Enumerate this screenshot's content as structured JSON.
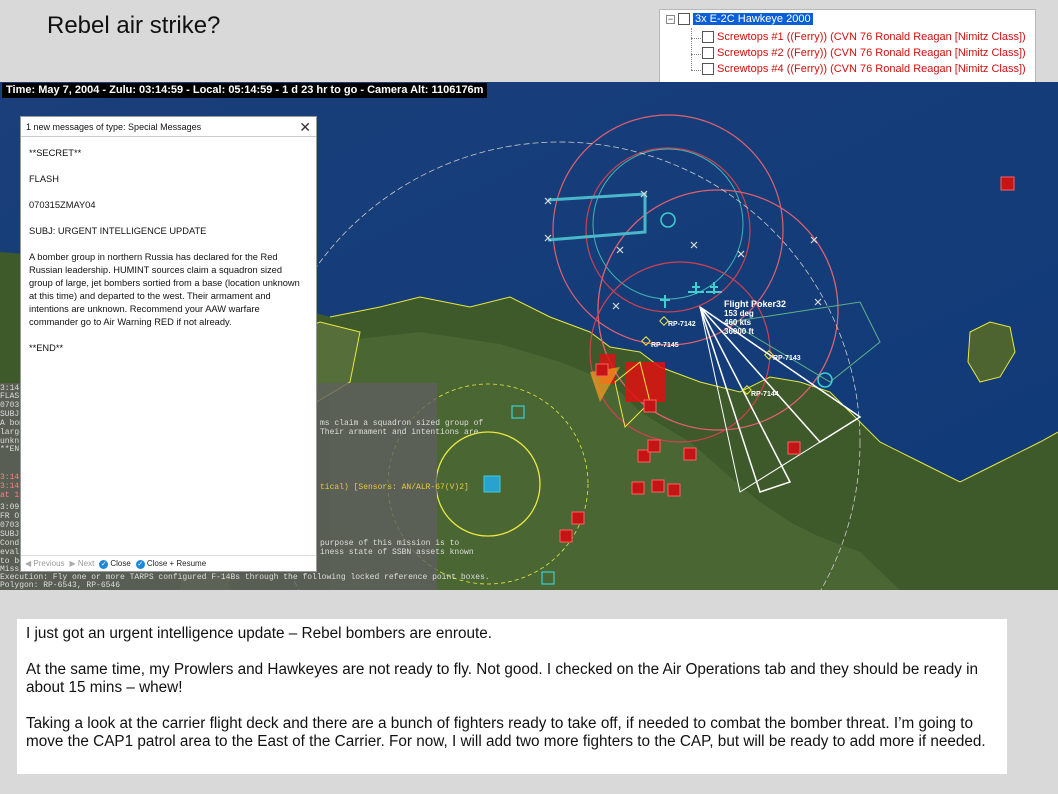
{
  "title": "Rebel air strike?",
  "unit_tree": {
    "root": "3x E-2C Hawkeye 2000",
    "children": [
      "Screwtops #1 ((Ferry)) (CVN 76 Ronald Reagan [Nimitz Class])",
      "Screwtops #2 ((Ferry)) (CVN 76 Ronald Reagan [Nimitz Class])",
      "Screwtops #4 ((Ferry)) (CVN 76 Ronald Reagan [Nimitz Class])"
    ]
  },
  "status_bar": "Time: May 7, 2004 - Zulu: 03:14:59 - Local: 05:14:59 - 1 d 23 hr to go -  Camera Alt: 1106176m",
  "map_labels": {
    "flight_name": "Flight Poker32",
    "flight_heading": "153 deg",
    "flight_speed": "460 kts",
    "flight_alt": "36000 ft",
    "rp1": "RP-7142",
    "rp2": "RP-7145",
    "rp3": "RP-7143",
    "rp4": "RP-7144"
  },
  "message": {
    "header": "1 new messages of type: Special Messages",
    "lines": [
      "**SECRET**",
      "FLASH",
      "070315ZMAY04",
      "SUBJ: URGENT INTELLIGENCE UPDATE",
      "A bomber group in northern Russia has declared for the Red Russian leadership. HUMINT sources claim a squadron sized group of large, jet bombers sortied from a base (location unknown at this time) and departed to the west. Their armament and intentions are unknown. Recommend your AAW warfare commander go to Air Warning RED if not already.",
      "**END**"
    ],
    "previous": "Previous",
    "next": "Next",
    "close": "Close",
    "close_resume": "Close + Resume"
  },
  "log_fragments": {
    "l1": "3:14:5",
    "l2": "FLAS",
    "l3": "0703",
    "l4": "SUBJ",
    "l5": "A bom",
    "l6": "large",
    "l7": "unkn",
    "l8": "**ENI",
    "l9": "ms claim a squadron sized group of",
    "l10": "Their armament and intentions are",
    "l11": "3:14:5",
    "l12": "3:14:",
    "l13": "at 19:",
    "l14": "tical)  [Sensors: AN/ALR-67(V)2]",
    "l15": "3:09:5",
    "l16": "FR O",
    "l17": "0703",
    "l18": "SUBJ",
    "l19": "Cond",
    "l20": "evalu",
    "l21": "to be",
    "l22": "Missi",
    "l23": "purpose of this mission is to",
    "l24": "iness state of SSBN assets known",
    "l25": "Execution: Fly one or more TARPS configured F-14Bs through the following locked reference point boxes.",
    "l26": "Polygon: RP-6543, RP-6546"
  },
  "commentary": [
    "I just got an urgent intelligence update – Rebel bombers are enroute.",
    "At the same time, my Prowlers and Hawkeyes are not ready to fly.  Not good.  I checked on the Air Operations tab and they should be ready in about 15 mins – whew!",
    "Taking a look at the carrier flight deck and there are a bunch of fighters ready to take off, if needed to combat the bomber threat.  I’m going to move the CAP1 patrol area to the East of the Carrier.  For now, I will add two more fighters to the CAP, but will be ready to add more if needed."
  ]
}
